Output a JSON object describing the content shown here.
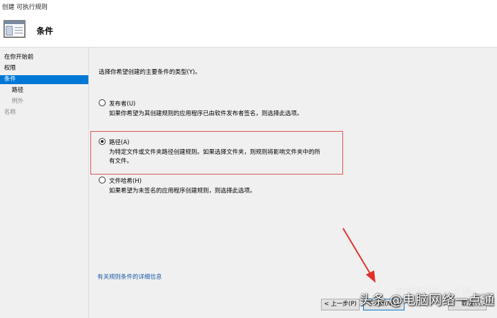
{
  "window": {
    "title": "创建 可执行规则"
  },
  "header": {
    "heading": "条件",
    "icon": "window-pane-icon"
  },
  "sidebar": {
    "items": [
      {
        "label": "在你开始前"
      },
      {
        "label": "权限"
      },
      {
        "label": "条件"
      },
      {
        "label": "路径"
      },
      {
        "label": "例外"
      },
      {
        "label": "名称"
      }
    ]
  },
  "main": {
    "prompt": "选择你希望创建的主要条件的类型(Y)。",
    "options": [
      {
        "label": "发布者(U)",
        "desc": [
          "如果你希望为其创建规则的应用程序已由软件发布者签名，则选择此选项。"
        ],
        "checked": false
      },
      {
        "label": "路径(A)",
        "desc": [
          "为特定文件或文件夹路径创建规则。如果选择文件夹，则规则将影响文件夹中的所",
          "有文件。"
        ],
        "checked": true
      },
      {
        "label": "文件哈希(H)",
        "desc": [
          "如果希望为未签名的应用程序创建规则，则选择此选项。"
        ],
        "checked": false
      }
    ],
    "link": "有关规则条件的详细信息"
  },
  "buttons": {
    "back": "< 上一步(P)",
    "next": "下一步(N) >",
    "cancel": "取消"
  },
  "watermark": {
    "main": "头条 @电脑网络一点通",
    "faint": "电脑网络一点通"
  },
  "colors": {
    "selected": "#0078d7",
    "highlight": "#d9534f",
    "arrow": "#e0312b",
    "link": "#1b5aa8"
  }
}
